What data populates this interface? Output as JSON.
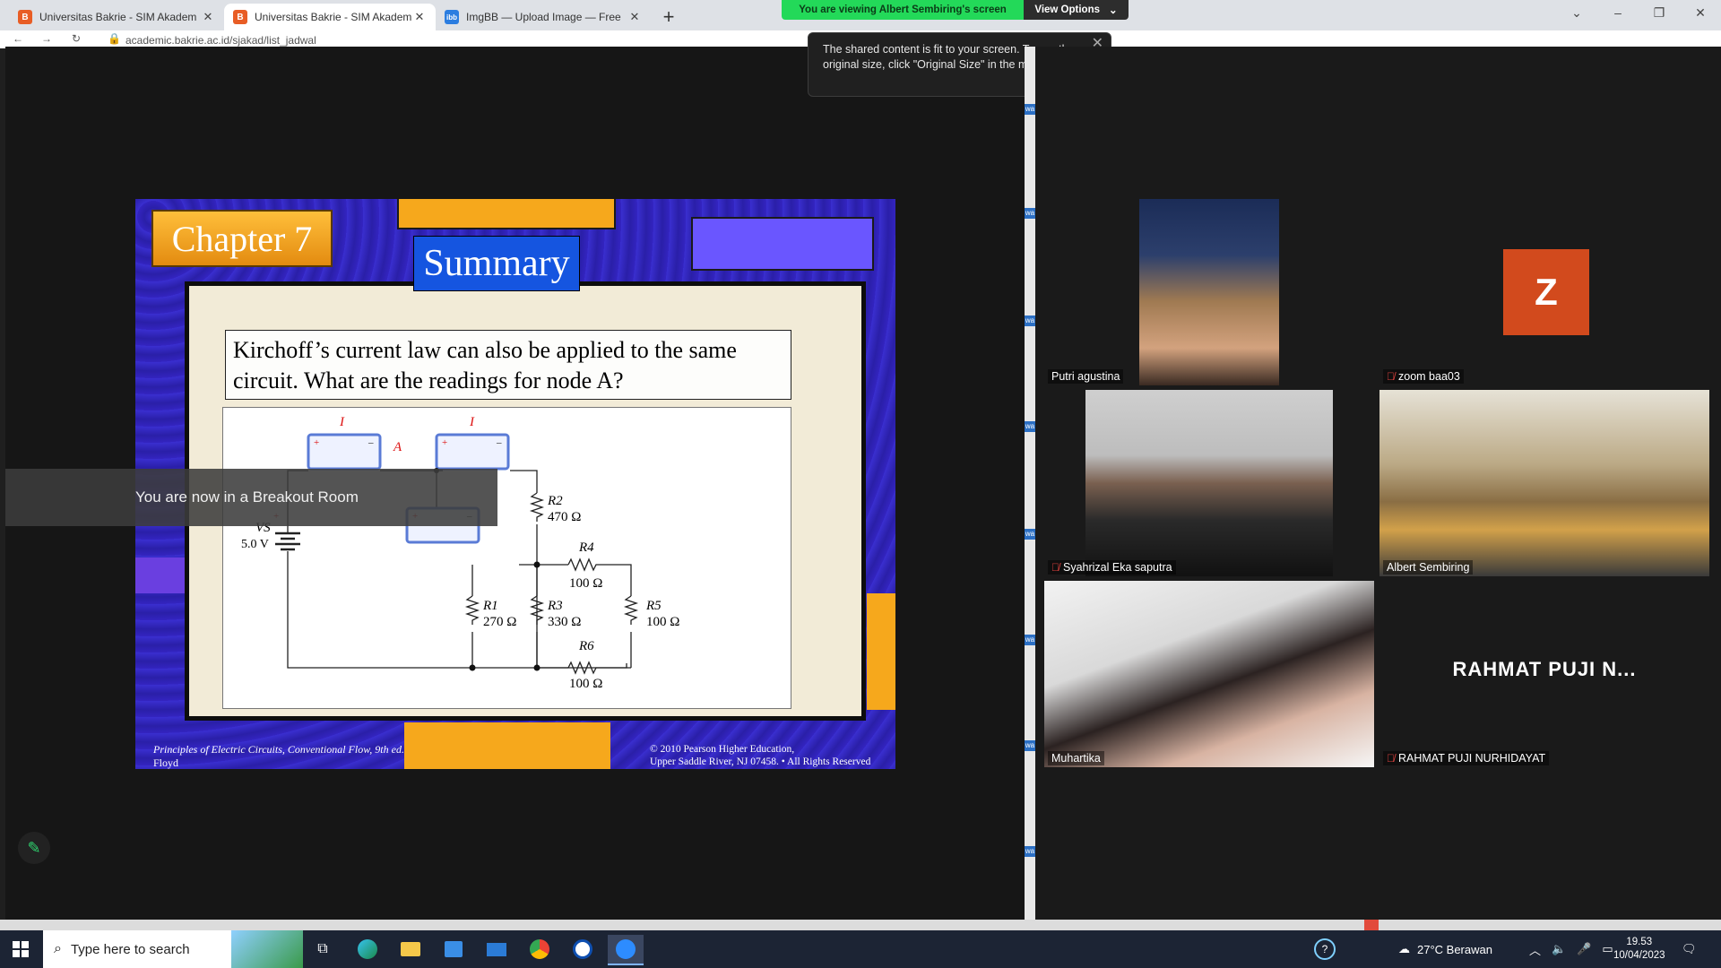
{
  "browser": {
    "tabs": [
      {
        "title": "Universitas Bakrie - SIM Akadem",
        "favicon": "B",
        "active": false
      },
      {
        "title": "Universitas Bakrie - SIM Akadem",
        "favicon": "B",
        "active": true
      },
      {
        "title": "ImgBB — Upload Image — Free",
        "favicon": "ibb",
        "active": false
      }
    ],
    "address": "academic.bakrie.ac.id/sjakad/list_jadwal"
  },
  "zoom": {
    "banner_text": "You are viewing Albert Sembiring's screen",
    "view_options_label": "View Options",
    "notice_text": "The shared content is fit to your screen. To see the original size, click \"Original Size\" in the menu.",
    "breakout_text": "You are now in a Breakout Room"
  },
  "slide": {
    "chapter": "Chapter 7",
    "heading": "Summary",
    "question": "Kirchoff’s current law can also be applied to the same circuit. What are the readings for node A?",
    "footer_left": "Principles of Electric Circuits, Conventional Flow, 9th ed.",
    "footer_left_author": "Floyd",
    "footer_right_line1": "© 2010 Pearson Higher Education,",
    "footer_right_line2": "Upper Saddle River, NJ 07458. • All Rights Reserved",
    "circuit": {
      "current_label": "I",
      "node_label": "A",
      "source_label": "VS",
      "source_value": "5.0 V",
      "resistors": [
        {
          "name": "R2",
          "value": "470 Ω"
        },
        {
          "name": "R4",
          "value": "100 Ω"
        },
        {
          "name": "R1",
          "value": "270 Ω"
        },
        {
          "name": "R3",
          "value": "330 Ω"
        },
        {
          "name": "R5",
          "value": "100 Ω"
        },
        {
          "name": "R6",
          "value": "100 Ω"
        }
      ]
    }
  },
  "participants": [
    {
      "name": "Putri agustina",
      "muted": false
    },
    {
      "name": "zoom baa03",
      "muted": true,
      "avatar_letter": "Z"
    },
    {
      "name": "Syahrizal Eka saputra",
      "muted": true
    },
    {
      "name": "Albert Sembiring",
      "muted": false,
      "active_speaker": true
    },
    {
      "name": "Muhartika",
      "muted": false
    },
    {
      "name": "RAHMAT PUJI NURHIDAYAT",
      "muted": true,
      "display_short": "RAHMAT PUJI N..."
    }
  ],
  "taskbar": {
    "search_placeholder": "Type here to search",
    "weather": "27°C  Berawan",
    "time": "19.53",
    "date": "10/04/2023"
  },
  "colors": {
    "share_banner": "#23d959",
    "active_speaker_border": "#f5e26b",
    "taskbar": "#1c2434",
    "slide_background": "#2a1fa8"
  }
}
